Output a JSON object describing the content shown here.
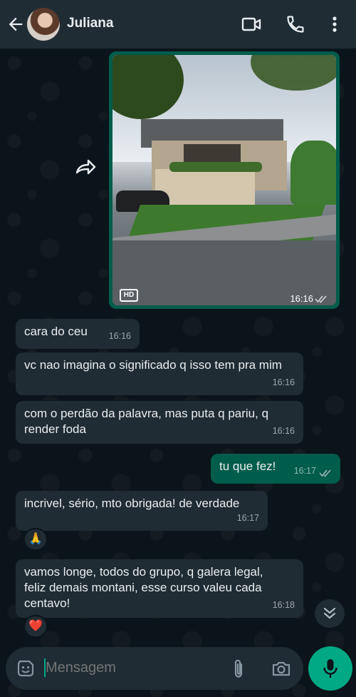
{
  "header": {
    "contact_name": "Juliana"
  },
  "image_message": {
    "badge": "HD",
    "time": "16:16",
    "status": "read"
  },
  "messages": [
    {
      "direction": "in",
      "text": "cara do ceu",
      "time": "16:16"
    },
    {
      "direction": "in",
      "text": "vc nao imagina o significado q isso tem pra mim",
      "time": "16:16"
    },
    {
      "direction": "in",
      "text": "com o perdão da palavra, mas puta q pariu, q render foda",
      "time": "16:16"
    },
    {
      "direction": "out",
      "text": "tu que fez!",
      "time": "16:17",
      "status": "read"
    },
    {
      "direction": "in",
      "text": "incrivel, sério, mto obrigada! de verdade",
      "time": "16:17",
      "reaction": "🙏"
    },
    {
      "direction": "in",
      "text": "vamos longe, todos do grupo, q galera legal, feliz demais montani, esse curso valeu cada centavo!",
      "time": "16:18",
      "reaction": "❤️"
    }
  ],
  "composer": {
    "placeholder": "Mensagem"
  },
  "colors": {
    "header_bg": "#1f2c34",
    "incoming_bubble": "#202c33",
    "outgoing_bubble": "#005c4b",
    "accent": "#00a884"
  }
}
